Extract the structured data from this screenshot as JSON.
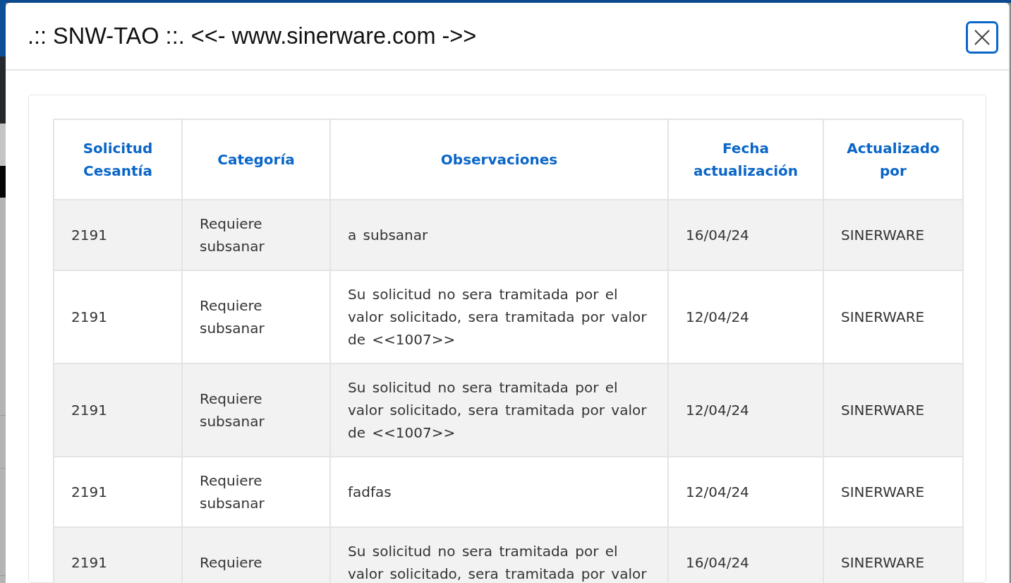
{
  "window": {
    "title": ".:: SNW-TAO ::. <<- www.sinerware.com ->>"
  },
  "table": {
    "columns": [
      "Solicitud Cesantía",
      "Categoría",
      "Observaciones",
      "Fecha actualización",
      "Actualizado por"
    ],
    "rows": [
      [
        "2191",
        "Requiere subsanar",
        "a subsanar",
        "16/04/24",
        "SINERWARE"
      ],
      [
        "2191",
        "Requiere subsanar",
        "Su solicitud no sera tramitada por el valor solicitado, sera tramitada por valor de <<1007>>",
        "12/04/24",
        "SINERWARE"
      ],
      [
        "2191",
        "Requiere subsanar",
        "Su solicitud no sera tramitada por el valor solicitado, sera tramitada por valor de <<1007>>",
        "12/04/24",
        "SINERWARE"
      ],
      [
        "2191",
        "Requiere subsanar",
        "fadfas",
        "12/04/24",
        "SINERWARE"
      ],
      [
        "2191",
        "Requiere",
        "Su solicitud no sera tramitada por el valor solicitado, sera tramitada por valor",
        "16/04/24",
        "SINERWARE"
      ]
    ]
  }
}
